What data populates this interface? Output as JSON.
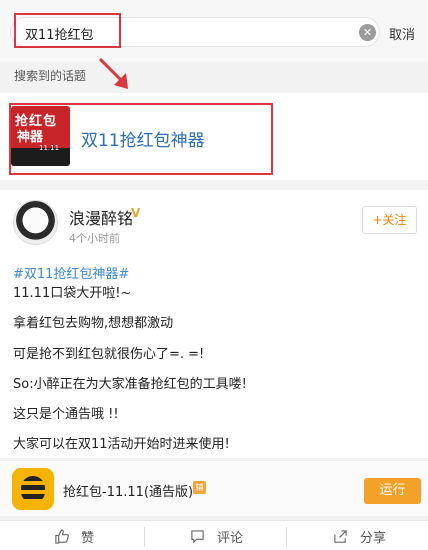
{
  "search": {
    "query": "双11抢红包",
    "clear_icon": "clear-icon",
    "cancel_label": "取消"
  },
  "section_label": "搜索到的话题",
  "topic": {
    "title": "双11抢红包神器",
    "thumb_line1": "抢红包",
    "thumb_line2": "神器",
    "thumb_line3": "11.11"
  },
  "post": {
    "username": "浪漫醉铭",
    "time": "4个小时前",
    "follow_label": "+关注",
    "lines": [
      "#双11抢红包神器#",
      "11.11口袋大开啦!~",
      "拿着红包去购物,想想都激动",
      "可是抢不到红包就很伤心了=. =!",
      "So:小醉正在为大家准备抢红包的工具喽!",
      "这只是个通告哦 !!",
      "大家可以在双11活动开始时进来使用!"
    ]
  },
  "app": {
    "name": "抢红包-11.11(通告版)",
    "badge": "辅",
    "run_label": "运行"
  },
  "actions": {
    "like": "赞",
    "comment": "评论",
    "share": "分享"
  },
  "colors": {
    "highlight_red": "#d9363e",
    "topic_blue": "#2b6fb5",
    "hashtag_blue": "#3a8ad6",
    "orange": "#f4a12a"
  }
}
